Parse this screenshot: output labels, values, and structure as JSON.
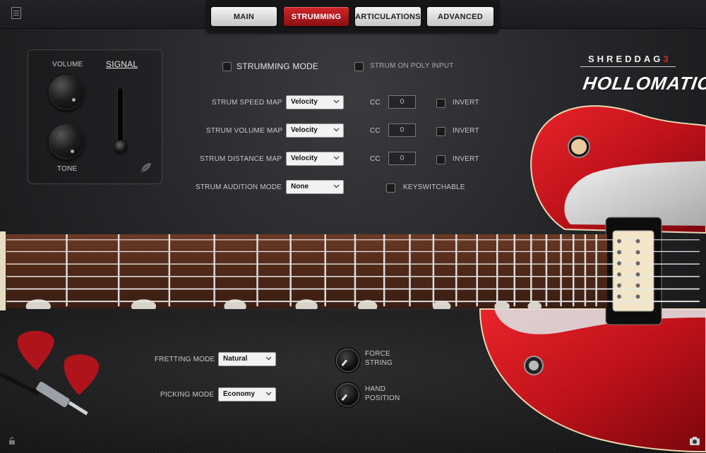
{
  "tabs": [
    {
      "label": "MAIN",
      "active": false
    },
    {
      "label": "STRUMMING",
      "active": true
    },
    {
      "label": "ARTICULATIONS",
      "active": false
    },
    {
      "label": "ADVANCED",
      "active": false
    }
  ],
  "signal_panel": {
    "volume_label": "VOLUME",
    "signal_label": "SIGNAL",
    "tone_label": "TONE"
  },
  "strumming": {
    "mode_label": "STRUMMING MODE",
    "mode_checked": false,
    "poly_label": "STRUM ON POLY INPUT",
    "poly_checked": false,
    "rows": [
      {
        "label": "STRUM SPEED MAP",
        "value": "Velocity",
        "cc_label": "CC",
        "cc_value": "0",
        "invert_label": "INVERT"
      },
      {
        "label": "STRUM VOLUME MAP",
        "value": "Velocity",
        "cc_label": "CC",
        "cc_value": "0",
        "invert_label": "INVERT"
      },
      {
        "label": "STRUM DISTANCE MAP",
        "value": "Velocity",
        "cc_label": "CC",
        "cc_value": "0",
        "invert_label": "INVERT"
      }
    ],
    "audition_label": "STRUM AUDITION MODE",
    "audition_value": "None",
    "keyswitch_label": "KEYSWITCHABLE"
  },
  "brand": {
    "top_prefix": "SHREDDAG",
    "top_suffix": "3",
    "main": "HOLLOMATIC"
  },
  "bottom": {
    "fretting_label": "FRETTING MODE",
    "fretting_value": "Natural",
    "picking_label": "PICKING MODE",
    "picking_value": "Economy",
    "force_label_1": "FORCE",
    "force_label_2": "STRING",
    "hand_label_1": "HAND",
    "hand_label_2": "POSITION"
  },
  "colors": {
    "accent": "#c0181c",
    "guitar_body": "#c8121a",
    "fretboard": "#5a3222"
  },
  "icons": [
    "document-icon",
    "leaf-icon",
    "chevron-down-icon",
    "lock-icon",
    "camera-icon"
  ]
}
